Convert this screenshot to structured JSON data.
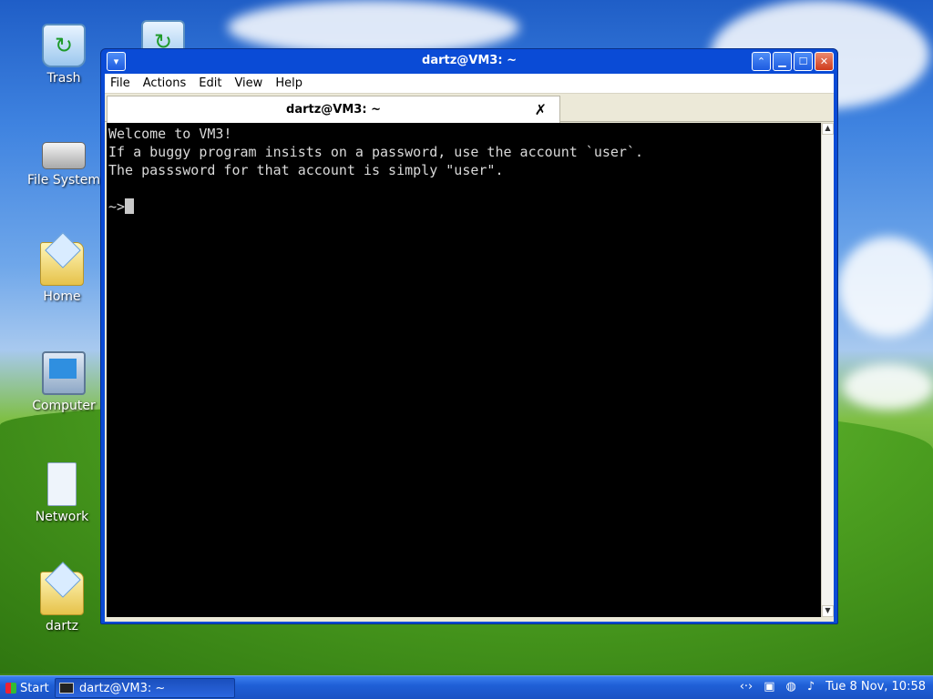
{
  "desktop": {
    "icons": [
      {
        "label": "Trash",
        "icon": "trash-icon"
      },
      {
        "label": "File System",
        "icon": "drive-icon"
      },
      {
        "label": "Home",
        "icon": "home-folder-icon"
      },
      {
        "label": "Computer",
        "icon": "computer-icon"
      },
      {
        "label": "Network",
        "icon": "network-icon"
      },
      {
        "label": "dartz",
        "icon": "folder-icon"
      }
    ]
  },
  "window": {
    "title": "dartz@VM3: ~",
    "menu": [
      "File",
      "Actions",
      "Edit",
      "View",
      "Help"
    ],
    "tab": {
      "label": "dartz@VM3: ~",
      "close": "✗"
    },
    "terminal": {
      "lines": [
        "Welcome to VM3!",
        "If a buggy program insists on a password, use the account `user`.",
        "The passsword for that account is simply \"user\".",
        "",
        "~>"
      ]
    }
  },
  "taskbar": {
    "start_label": "Start",
    "task_label": "dartz@VM3: ~",
    "clock": "Tue  8 Nov, 10:58"
  }
}
